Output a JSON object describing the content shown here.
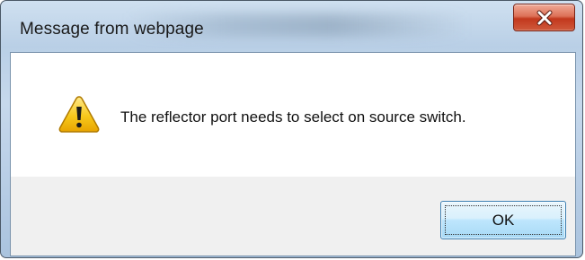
{
  "window": {
    "title": "Message from webpage"
  },
  "dialog": {
    "icon": "warning-icon",
    "message": "The reflector port needs to select on source switch.",
    "ok_label": "OK"
  },
  "colors": {
    "close_button": "#c9452b",
    "ok_button_border": "#3c7fb1",
    "footer_background": "#f0f0f0",
    "warning_icon": "#f4c20d"
  }
}
